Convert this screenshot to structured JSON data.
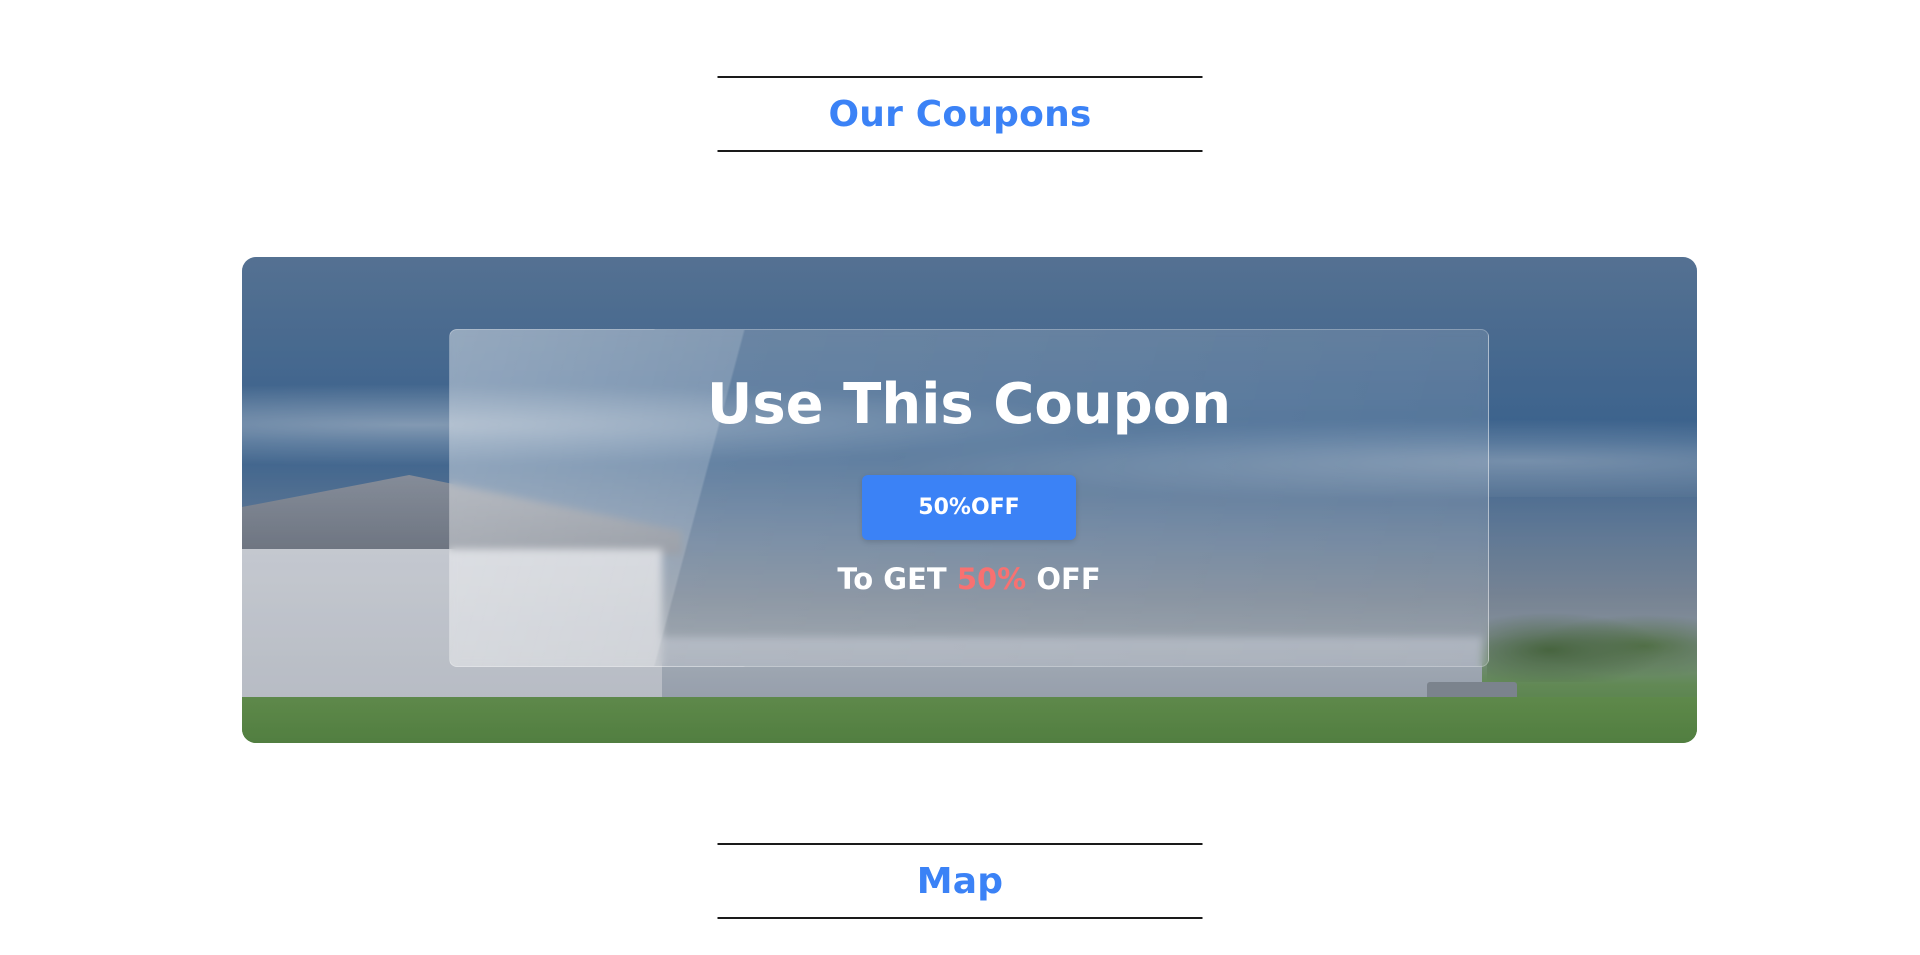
{
  "coupons_section": {
    "heading": "Our Coupons"
  },
  "coupon_banner": {
    "title": "Use This Coupon",
    "code_button_label": "50%OFF",
    "description_prefix": "To GET",
    "description_highlight": "50%",
    "description_suffix": "OFF",
    "colors": {
      "accent": "#3b82f6",
      "highlight": "#f87171",
      "text": "#ffffff"
    }
  },
  "map_section": {
    "heading": "Map"
  },
  "colors": {
    "heading": "#3b82f6",
    "heading_rule": "#1a1a1a",
    "background": "#ffffff"
  }
}
